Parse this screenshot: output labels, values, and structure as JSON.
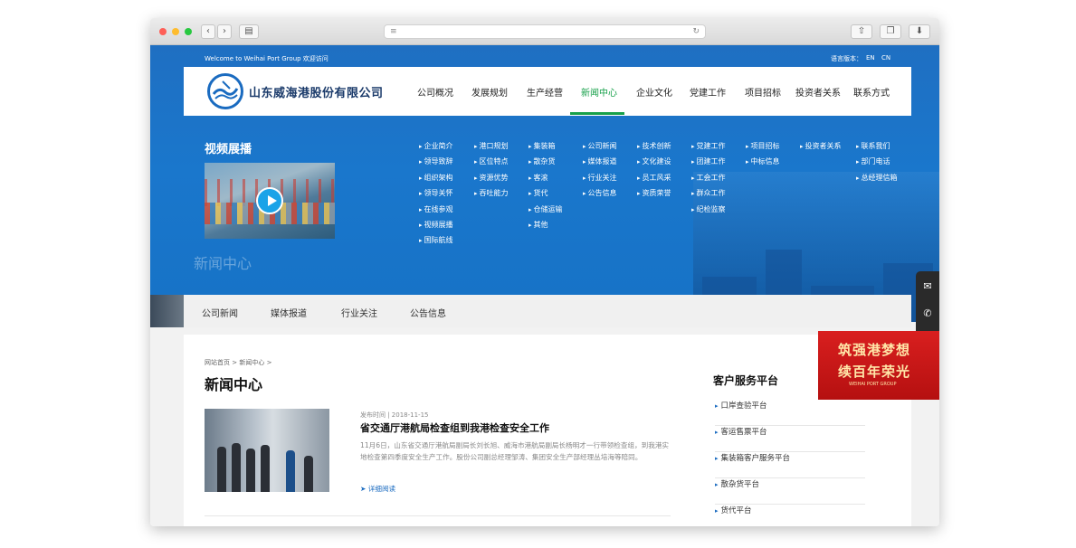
{
  "browser": {
    "back_icon": "chevron-left-icon",
    "forward_icon": "chevron-right-icon",
    "sidebar_icon": "sidebar-icon",
    "reader_icon": "reader-icon",
    "reload_icon": "reload-icon",
    "share_icon": "share-icon",
    "tabs_icon": "tabs-icon",
    "download_icon": "download-icon",
    "traffic_colors": [
      "#fe5f57",
      "#febc2e",
      "#28c840"
    ]
  },
  "topbar": {
    "welcome": "Welcome to Weihai Port Group 欢迎访问",
    "lang_label": "语言版本：",
    "lang_en": "EN",
    "lang_cn": "CN"
  },
  "brand": {
    "name": "山东威海港股份有限公司",
    "accent": "#1a6bc0",
    "active_color": "#17a04a"
  },
  "nav": {
    "items": [
      {
        "label": "公司概况"
      },
      {
        "label": "发展规划"
      },
      {
        "label": "生产经营"
      },
      {
        "label": "新闻中心"
      },
      {
        "label": "企业文化"
      },
      {
        "label": "党建工作"
      },
      {
        "label": "项目招标"
      },
      {
        "label": "投资者关系"
      },
      {
        "label": "联系方式"
      }
    ],
    "active_index": 3
  },
  "mega": {
    "title": "视频展播",
    "columns": [
      [
        "企业简介",
        "领导致辞",
        "组织架构",
        "领导关怀",
        "在线参观",
        "视频展播",
        "国际航线"
      ],
      [
        "港口规划",
        "区位特点",
        "资源优势",
        "吞吐能力"
      ],
      [
        "集装箱",
        "散杂货",
        "客滚",
        "货代",
        "仓储运输",
        "其他"
      ],
      [
        "公司新闻",
        "媒体报道",
        "行业关注",
        "公告信息"
      ],
      [
        "技术创新",
        "文化建设",
        "员工风采",
        "资质荣誉"
      ],
      [
        "党建工作",
        "团建工作",
        "工会工作",
        "群众工作",
        "纪检监察"
      ],
      [
        "项目招标",
        "中标信息"
      ],
      [
        "投资者关系"
      ],
      [
        "联系我们",
        "部门电话",
        "总经理信箱"
      ]
    ]
  },
  "hero": {
    "title": "新闻中心"
  },
  "subnav": {
    "items": [
      "公司新闻",
      "媒体报道",
      "行业关注",
      "公告信息"
    ]
  },
  "breadcrumb": {
    "home": "网站首页",
    "separator": ">",
    "current": "新闻中心",
    "trailing": ">"
  },
  "main": {
    "title": "新闻中心",
    "news": [
      {
        "date": "发布时间 | 2018-11-15",
        "title": "省交通厅港航局检查组到我港检查安全工作",
        "body": "11月6日，山东省交通厅港航局副局长刘长旭、威海市港航局副局长杨明才一行带领检查组，到我港实地检查第四季度安全生产工作。股份公司副总经理邹涛、集团安全生产部经理丛培海等陪同。",
        "more": "详细阅读"
      }
    ]
  },
  "sidebar": {
    "title": "客户服务平台",
    "items": [
      "口岸查验平台",
      "客运售票平台",
      "集装箱客户服务平台",
      "散杂货平台",
      "货代平台"
    ]
  },
  "float": {
    "icons": [
      "mail-icon",
      "phone-icon",
      "wechat-icon"
    ]
  },
  "banner": {
    "line1": "筑强港梦想",
    "line2": "续百年荣光",
    "line3": "WEIHAI PORT GROUP"
  }
}
